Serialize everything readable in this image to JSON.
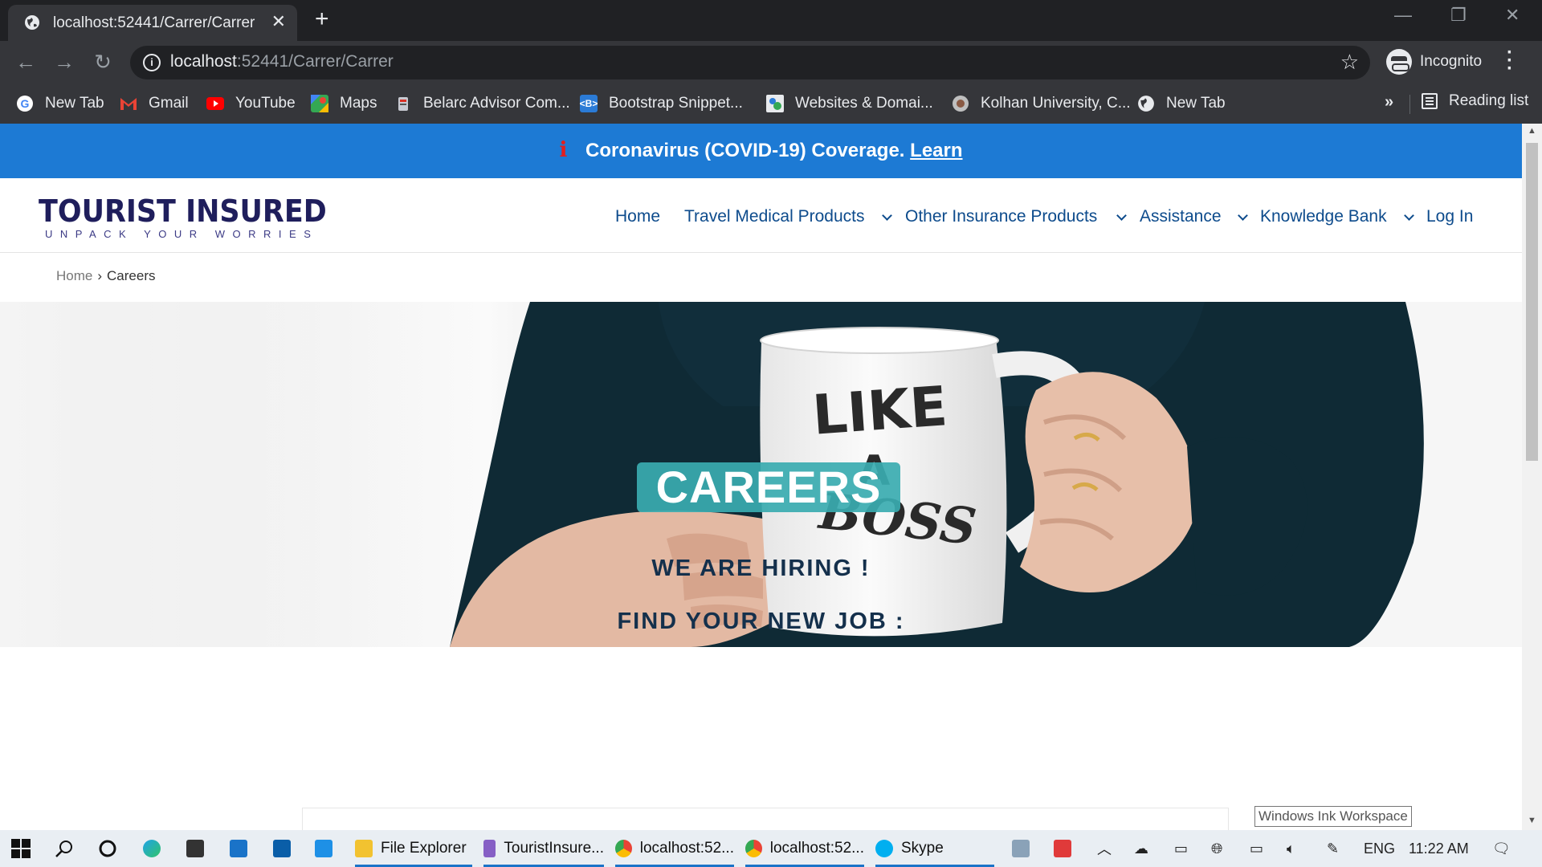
{
  "browser": {
    "tab_title": "localhost:52441/Carrer/Carrer",
    "url_host": "localhost",
    "url_path": ":52441/Carrer/Carrer",
    "profile_label": "Incognito",
    "bookmarks": [
      {
        "label": "New Tab",
        "icon": "google-icon"
      },
      {
        "label": "Gmail",
        "icon": "gmail-icon"
      },
      {
        "label": "YouTube",
        "icon": "youtube-icon"
      },
      {
        "label": "Maps",
        "icon": "maps-icon"
      },
      {
        "label": "Belarc Advisor Com...",
        "icon": "belarc-icon"
      },
      {
        "label": "Bootstrap Snippet...",
        "icon": "bootstrap-icon"
      },
      {
        "label": "Websites & Domai...",
        "icon": "websites-icon"
      },
      {
        "label": "Kolhan University, C...",
        "icon": "kolhan-icon"
      },
      {
        "label": "New Tab",
        "icon": "globe-icon"
      }
    ],
    "more_bookmarks": "»",
    "reading_list": "Reading list"
  },
  "banner": {
    "icon": "i",
    "text": "Coronavirus (COVID-19) Coverage.",
    "link": "Learn"
  },
  "site": {
    "logo_main": "TOURIST INSURED",
    "logo_tagline": "UNPACK YOUR WORRIES",
    "nav": {
      "home": "Home",
      "travel": "Travel Medical Products",
      "other": "Other Insurance Products",
      "assistance": "Assistance",
      "knowledge": "Knowledge Bank",
      "login": "Log In"
    },
    "breadcrumb": {
      "home": "Home",
      "separator": "›",
      "current": "Careers"
    }
  },
  "hero": {
    "title": "CAREERS",
    "mug_text_1": "LIKE",
    "mug_text_2": "A",
    "mug_text_3": "BOSS"
  },
  "content": {
    "heading_1": "WE ARE HIRING !",
    "heading_2": "FIND YOUR NEW JOB :"
  },
  "tooltip": "Windows Ink Workspace",
  "taskbar": {
    "apps": [
      {
        "label": "File Explorer"
      },
      {
        "label": "TouristInsure..."
      },
      {
        "label": "localhost:52..."
      },
      {
        "label": "localhost:52..."
      },
      {
        "label": "Skype"
      }
    ],
    "language": "ENG",
    "time": "11:22 AM"
  },
  "colors": {
    "banner_bg": "#1d7ad4",
    "nav_text": "#0d4b8c",
    "careers_badge": "#3aabb0",
    "heading": "#14304c"
  }
}
